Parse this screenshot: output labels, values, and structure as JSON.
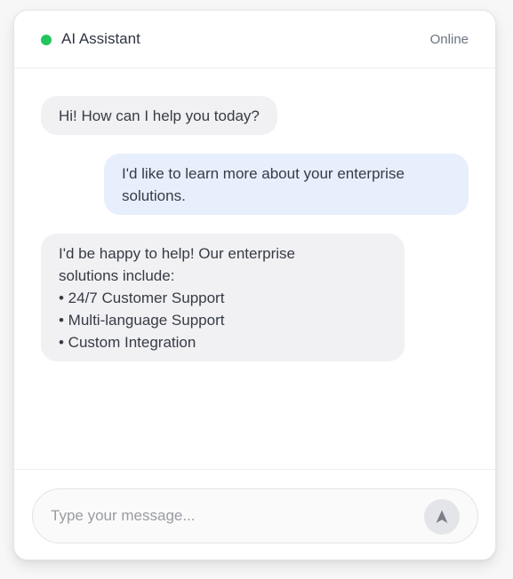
{
  "header": {
    "title": "AI Assistant",
    "status": "Online",
    "status_color": "#22c55e"
  },
  "messages": [
    {
      "role": "assistant",
      "lines": [
        "Hi! How can I help you today?"
      ]
    },
    {
      "role": "user",
      "lines": [
        "I'd like to learn more about your enterprise",
        "solutions."
      ]
    },
    {
      "role": "assistant",
      "lines": [
        "I'd be happy to help! Our enterprise",
        "solutions include:",
        "• 24/7 Customer Support",
        "• Multi-language Support",
        "• Custom Integration"
      ]
    }
  ],
  "composer": {
    "value": "",
    "placeholder": "Type your message...",
    "send_icon": "send-icon"
  },
  "colors": {
    "assistant_bubble": "#f1f1f3",
    "user_bubble": "#e7effd",
    "send_button": "#e4e5e9"
  }
}
